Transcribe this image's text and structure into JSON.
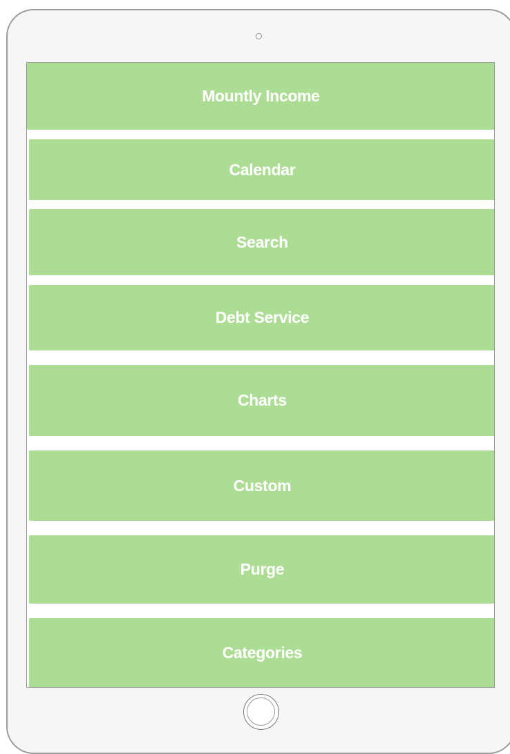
{
  "theme": {
    "button_color": "#addd94",
    "button_text_color": "#ffffff"
  },
  "menu": {
    "items": [
      {
        "id": "monthly-income",
        "label": "Mountly Income"
      },
      {
        "id": "calendar",
        "label": "Calendar"
      },
      {
        "id": "search",
        "label": "Search"
      },
      {
        "id": "debt-service",
        "label": "Debt Service"
      },
      {
        "id": "charts",
        "label": "Charts"
      },
      {
        "id": "custom",
        "label": "Custom"
      },
      {
        "id": "purge",
        "label": "Purge"
      },
      {
        "id": "categories",
        "label": "Categories"
      }
    ]
  }
}
